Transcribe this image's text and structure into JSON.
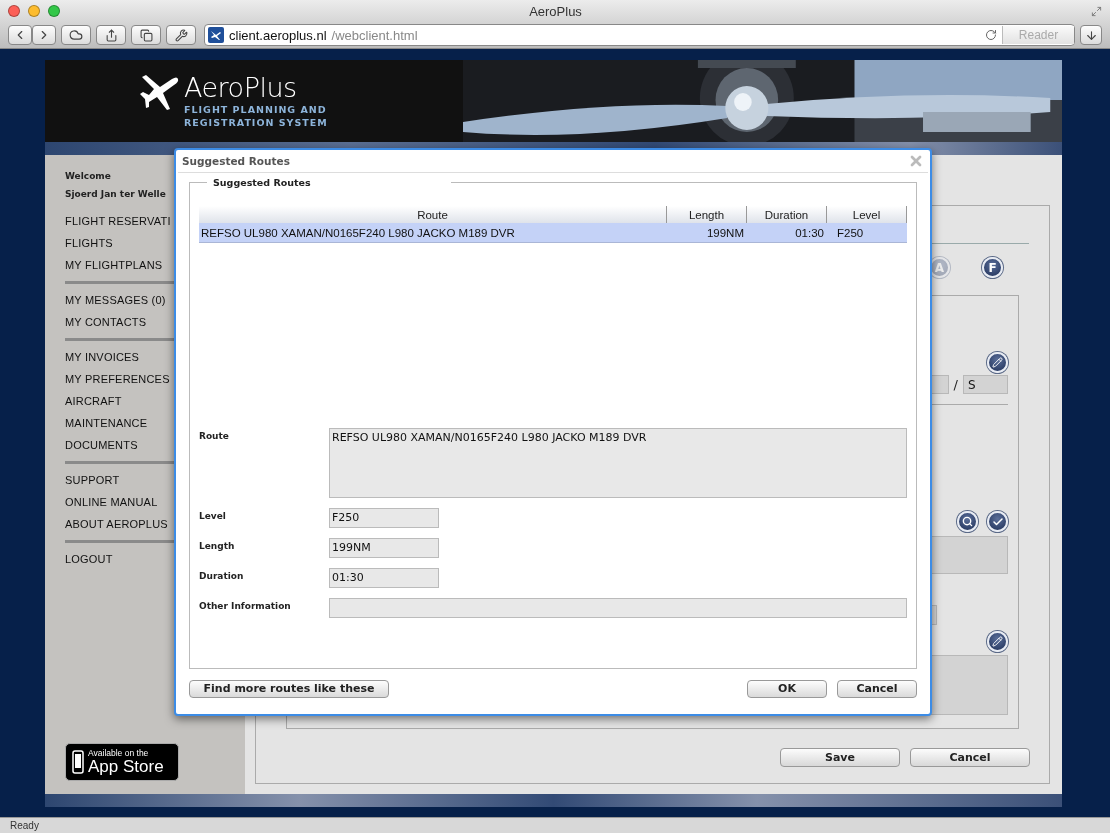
{
  "browser": {
    "title": "AeroPlus",
    "url_host": "client.aeroplus.nl",
    "url_path": "/webclient.html",
    "reader_button": "Reader",
    "status": "Ready"
  },
  "header": {
    "logo_name": "AeroPlus",
    "tagline_lines": [
      "FLIGHT PLANNING AND",
      "REGISTRATION SYSTEM"
    ]
  },
  "sidebar": {
    "welcome": "Welcome",
    "user": "Sjoerd Jan ter Welle",
    "menu_groups": [
      [
        "FLIGHT RESERVATI",
        "FLIGHTS",
        "MY FLIGHTPLANS"
      ],
      [
        "MY MESSAGES (0)",
        "MY CONTACTS"
      ],
      [
        "MY INVOICES",
        "MY PREFERENCES",
        "AIRCRAFT",
        "MAINTENANCE",
        "DOCUMENTS"
      ],
      [
        "SUPPORT",
        "ONLINE MANUAL",
        "ABOUT AEROPLUS"
      ],
      [
        "LOGOUT"
      ]
    ],
    "app_store": {
      "small": "Available on the",
      "big": "App Store"
    }
  },
  "main": {
    "letter_buttons": [
      {
        "label": "A",
        "disabled": true
      },
      {
        "label": "F",
        "disabled": false
      }
    ],
    "field_separator": "/",
    "field_value": "S",
    "buttons": [
      "Save",
      "Cancel"
    ]
  },
  "dialog": {
    "title": "Suggested Routes",
    "legend": "Suggested Routes",
    "columns": [
      "Route",
      "Length",
      "Duration",
      "Level"
    ],
    "rows": [
      {
        "route": "REFSO UL980 XAMAN/N0165F240 L980 JACKO M189 DVR",
        "length": "199NM",
        "duration": "01:30",
        "level": "F250",
        "selected": true
      }
    ],
    "fields": [
      {
        "label": "Route",
        "value": "REFSO UL980 XAMAN/N0165F240 L980 JACKO M189 DVR",
        "kind": "textarea"
      },
      {
        "label": "Level",
        "value": "F250",
        "kind": "short"
      },
      {
        "label": "Length",
        "value": "199NM",
        "kind": "short"
      },
      {
        "label": "Duration",
        "value": "01:30",
        "kind": "short"
      },
      {
        "label": "Other Information",
        "kind": "wide"
      }
    ],
    "find_button": "Find more routes like these",
    "ok_button": "OK",
    "cancel_button": "Cancel"
  }
}
